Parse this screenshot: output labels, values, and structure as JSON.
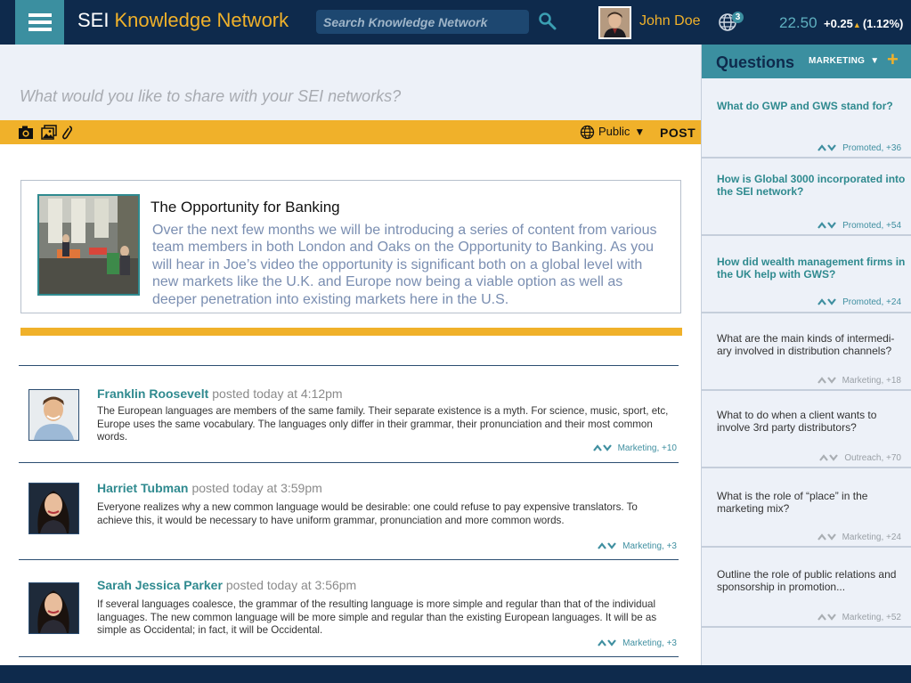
{
  "header": {
    "brand_prefix": "SEI",
    "brand_name": "Knowledge Network",
    "search_placeholder": "Search Knowledge Network",
    "user_name": "John Doe",
    "notification_count": "3",
    "price": "22.50",
    "change": "+0.25",
    "change_pct": "(1.12%)"
  },
  "composer": {
    "placeholder": "What would you like to share with your SEI networks?",
    "privacy": "Public",
    "post_label": "POST"
  },
  "feature": {
    "title": "The Opportunity for Banking",
    "body": "Over the next few months we will be introducing a series of content from various team members in both London and Oaks on the Opportunity to Bank­ing. As you will hear in Joe’s video the opportunity is significant both on a global level with new markets like the U.K. and Europe now being a viable option as well as deeper penetration into existing markets here in the U.S."
  },
  "posts": [
    {
      "author": "Franklin Roosevelt",
      "time": "posted today at 4:12pm",
      "body": "The European languages are members of the same family. Their separate existence is a myth. For science, music, sport, etc, Europe uses the same vocabulary. The languages only differ in their grammar, their pronunciation and their most common words.",
      "meta": "Marketing, +10"
    },
    {
      "author": "Harriet Tubman",
      "time": "posted today at 3:59pm",
      "body": "Everyone realizes why a new common language would be desirable: one could refuse to pay expensive translators. To achieve this, it would be necessary to have uniform grammar, pronunciation and more common words.",
      "meta": "Marketing, +3"
    },
    {
      "author": "Sarah Jessica Parker",
      "time": "posted today at 3:56pm",
      "body": "If several languages coalesce, the grammar of the resulting language is more simple and regular than that of the individual languages. The new common language will be more simple and regular than the existing European languages. It will be as simple as Occidental; in fact, it will be Occidental.",
      "meta": "Marketing, +3"
    }
  ],
  "questions": {
    "title": "Questions",
    "filter": "MARKETING",
    "items": [
      {
        "text": "What do GWP and GWS stand for?",
        "meta": "Promoted, +36",
        "promoted": true
      },
      {
        "text": "How is Global 3000 incorporated into the SEI network?",
        "meta": "Promoted, +54",
        "promoted": true
      },
      {
        "text": "How did wealth management firms in the UK help with GWS?",
        "meta": "Promoted, +24",
        "promoted": true
      },
      {
        "text": "What are the main kinds of intermedi­ary involved in distribution channels?",
        "meta": "Marketing, +18",
        "promoted": false
      },
      {
        "text": "What to do when a client wants to involve 3rd party distributors?",
        "meta": "Outreach, +70",
        "promoted": false
      },
      {
        "text": "What is the role of “place” in the marketing mix?",
        "meta": "Marketing, +24",
        "promoted": false
      },
      {
        "text": "Outline the role of public relations and sponsorship in promotion...",
        "meta": "Marketing, +52",
        "promoted": false
      }
    ]
  },
  "colors": {
    "navy": "#0e2a4c",
    "teal": "#3b8fa0",
    "gold": "#f0b12a",
    "panel": "#edf1f8"
  }
}
